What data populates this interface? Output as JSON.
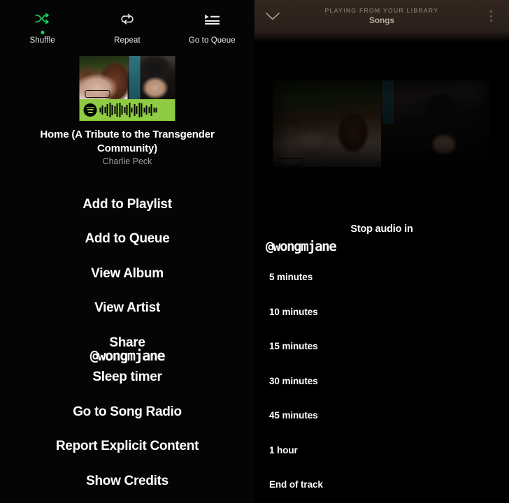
{
  "left": {
    "top_actions": [
      {
        "icon": "shuffle-icon",
        "label": "Shuffle",
        "active": true
      },
      {
        "icon": "repeat-icon",
        "label": "Repeat",
        "active": false
      },
      {
        "icon": "queue-icon",
        "label": "Go to Queue",
        "active": false
      }
    ],
    "now_playing": {
      "title": "Home (A Tribute to the Transgender Community)",
      "artist": "Charlie Peck"
    },
    "menu_items": [
      "Add to Playlist",
      "Add to Queue",
      "View Album",
      "View Artist",
      "Share",
      "Sleep timer",
      "Go to Song Radio",
      "Report Explicit Content",
      "Show Credits"
    ],
    "watermark": "@wongmjane"
  },
  "right": {
    "header": {
      "context_label": "PLAYING FROM YOUR LIBRARY",
      "context_name": "Songs",
      "collapse_icon": "chevron-down-icon",
      "overflow_icon": "more-vertical-icon"
    },
    "sleep_timer": {
      "title": "Stop audio in",
      "options": [
        "5 minutes",
        "10 minutes",
        "15 minutes",
        "30 minutes",
        "45 minutes",
        "1 hour",
        "End of track"
      ]
    },
    "watermark": "@wongmjane"
  },
  "colors": {
    "accent_green": "#1ed760",
    "code_green": "#8fcc43",
    "background": "#000000",
    "header_brown": "#32261f",
    "text_primary": "#ffffff",
    "text_muted": "#a0a0a0"
  }
}
